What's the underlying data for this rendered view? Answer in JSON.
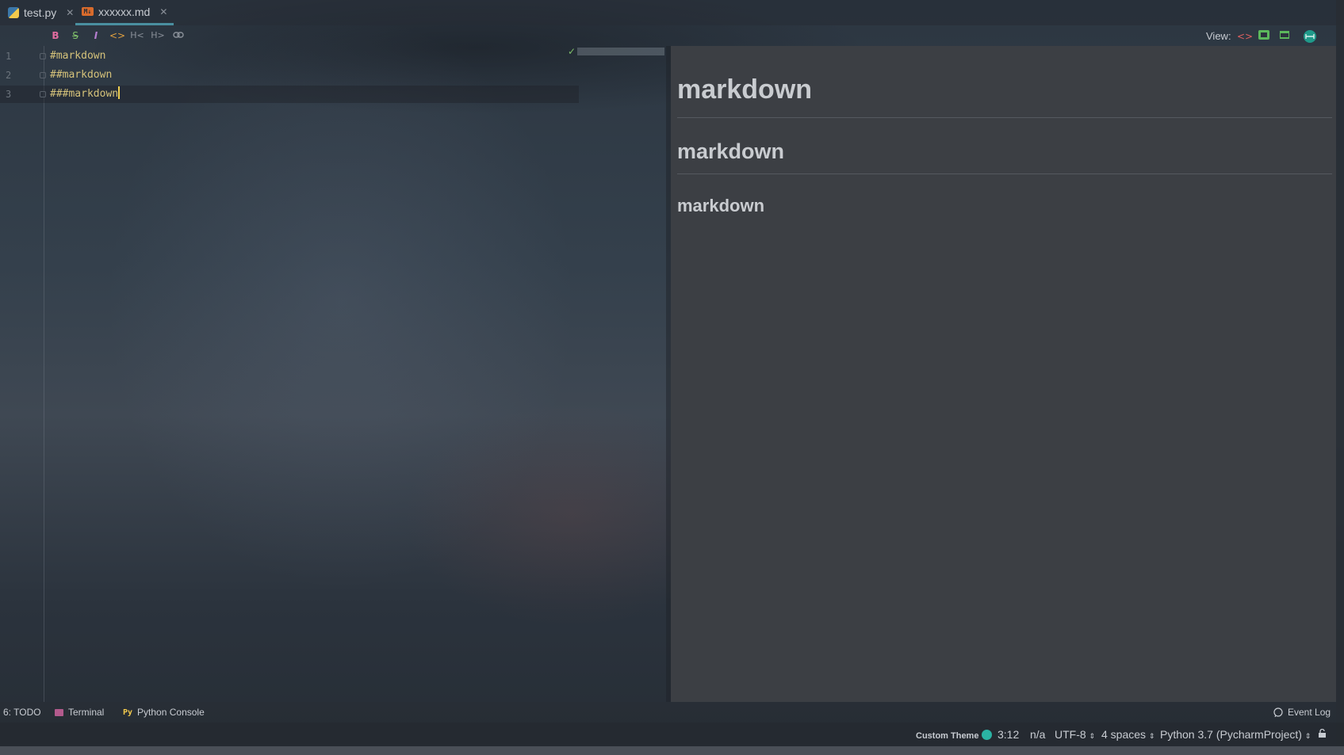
{
  "tabs": [
    {
      "label": "test.py",
      "icon": "python-file-icon",
      "active": false
    },
    {
      "label": "xxxxxx.md",
      "icon": "markdown-file-icon",
      "active": true
    }
  ],
  "md_toolbar": {
    "bold": "B",
    "strike": "S",
    "italic": "I",
    "code": "<>",
    "header_down": "H<",
    "header_up": "H>",
    "link": "link-icon"
  },
  "view": {
    "label": "View:"
  },
  "editor": {
    "lines": [
      {
        "num": "1",
        "text": "#markdown"
      },
      {
        "num": "2",
        "text": "##markdown"
      },
      {
        "num": "3",
        "text": "###markdown"
      }
    ]
  },
  "preview": {
    "h1": "markdown",
    "h2": "markdown",
    "h3": "markdown"
  },
  "tool_windows": {
    "todo": "6: TODO",
    "terminal": "Terminal",
    "python_console": "Python Console",
    "event_log": "Event Log"
  },
  "status": {
    "theme": "Custom Theme",
    "position": "3:12",
    "na": "n/a",
    "encoding": "UTF-8",
    "indent": "4 spaces",
    "interpreter": "Python 3.7 (PycharmProject)"
  },
  "colors": {
    "accent": "#4a8fa0",
    "heading_code": "#d5c27a",
    "theme_dot": "#2bb3a4"
  }
}
